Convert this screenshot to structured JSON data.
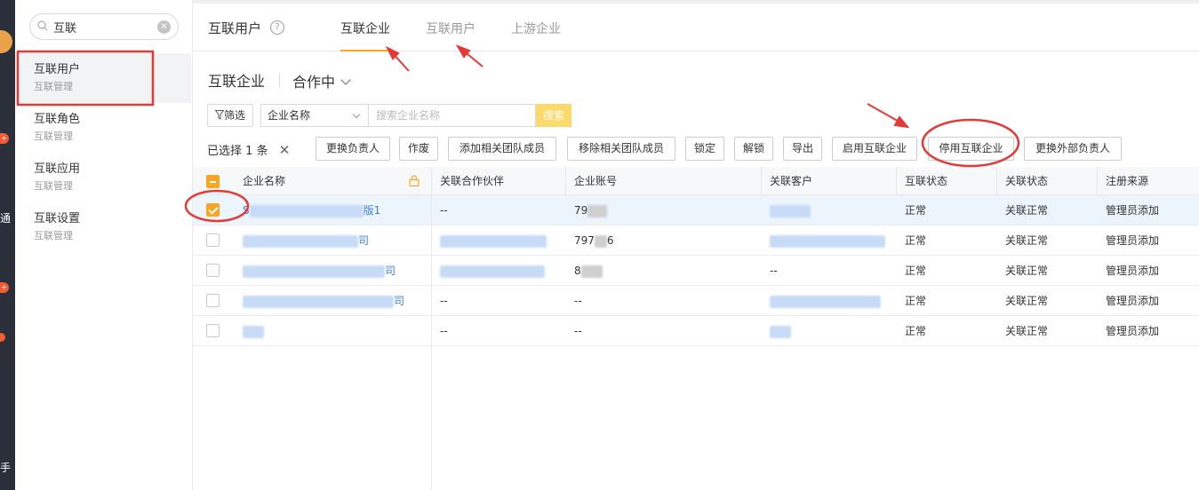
{
  "sidebar": {
    "search_value": "互联",
    "items": [
      {
        "title": "互联用户",
        "subtitle": "互联管理",
        "active": true
      },
      {
        "title": "互联角色",
        "subtitle": "互联管理"
      },
      {
        "title": "互联应用",
        "subtitle": "互联管理"
      },
      {
        "title": "互联设置",
        "subtitle": "互联管理"
      }
    ]
  },
  "rail": {
    "badge_1": "+",
    "badge_2": "+",
    "glyph_1": "通",
    "glyph_2": "手"
  },
  "header": {
    "title": "互联用户",
    "help_icon": "?",
    "tabs": [
      {
        "label": "互联企业",
        "active": true
      },
      {
        "label": "互联用户"
      },
      {
        "label": "上游企业"
      }
    ]
  },
  "section": {
    "title": "互联企业",
    "status": "合作中"
  },
  "filter": {
    "filter_label": "筛选",
    "field": "企业名称",
    "placeholder": "搜索企业名称",
    "search_label": "搜索"
  },
  "actions": {
    "selected_prefix": "已选择",
    "selected_count": "1",
    "selected_suffix": "条",
    "buttons": [
      "更换负责人",
      "作废",
      "添加相关团队成员",
      "移除相关团队成员",
      "锁定",
      "解锁",
      "导出",
      "启用互联企业",
      "停用互联企业",
      "更换外部负责人"
    ]
  },
  "table": {
    "headers": [
      "企业名称",
      "关联合作伙伴",
      "企业账号",
      "关联客户",
      "互联状态",
      "关联状态",
      "注册来源"
    ],
    "rows": [
      {
        "name_prefix": "S",
        "name_suffix": "版1",
        "partner": "--",
        "account": "79",
        "customer": "",
        "status": "正常",
        "link_status": "关联正常",
        "source": "管理员添加",
        "checked": true
      },
      {
        "name_prefix": "",
        "name_suffix": "司",
        "partner": "",
        "account": "797",
        "account_tail": "6",
        "customer": "",
        "status": "正常",
        "link_status": "关联正常",
        "source": "管理员添加",
        "checked": false
      },
      {
        "name_prefix": "",
        "name_suffix": "司",
        "partner": "",
        "account": "8",
        "customer": "--",
        "status": "正常",
        "link_status": "关联正常",
        "source": "管理员添加",
        "checked": false
      },
      {
        "name_prefix": "",
        "name_suffix": "司",
        "partner": "--",
        "account": "--",
        "customer": "",
        "status": "正常",
        "link_status": "关联正常",
        "source": "管理员添加",
        "checked": false
      },
      {
        "name_prefix": "",
        "name_suffix": "",
        "partner": "--",
        "account": "--",
        "customer": "",
        "status": "正常",
        "link_status": "关联正常",
        "source": "管理员添加",
        "checked": false
      }
    ]
  },
  "colors": {
    "accent": "#f8a523",
    "link": "#3b7ede",
    "annotation": "#e53935"
  }
}
